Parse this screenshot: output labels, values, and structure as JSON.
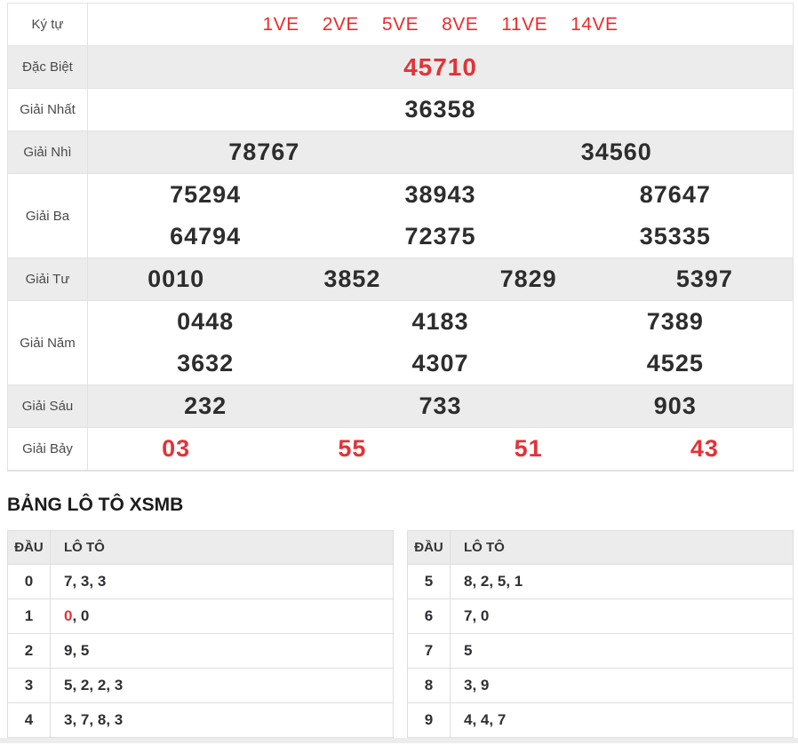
{
  "colors": {
    "red_accent": "#e23337",
    "symbol_red": "#ee2b2b",
    "number_dark": "#2d2d2d",
    "row_shade": "#ececec",
    "border": "#dedede"
  },
  "results_table": {
    "rows": [
      {
        "name": "ky-tu",
        "label": "Ký tự",
        "style": "symbols",
        "red": true,
        "shade": false,
        "lines": [
          [
            "1VE",
            "2VE",
            "5VE",
            "8VE",
            "11VE",
            "14VE"
          ]
        ]
      },
      {
        "name": "dac-biet",
        "label": "Đặc Biệt",
        "style": "special",
        "red": true,
        "shade": true,
        "lines": [
          [
            "45710"
          ]
        ]
      },
      {
        "name": "giai-nhat",
        "label": "Giải Nhất",
        "style": "",
        "red": false,
        "shade": false,
        "lines": [
          [
            "36358"
          ]
        ]
      },
      {
        "name": "giai-nhi",
        "label": "Giải Nhì",
        "style": "",
        "red": false,
        "shade": true,
        "lines": [
          [
            "78767",
            "34560"
          ]
        ]
      },
      {
        "name": "giai-ba",
        "label": "Giải Ba",
        "style": "",
        "red": false,
        "shade": false,
        "lines": [
          [
            "75294",
            "38943",
            "87647"
          ],
          [
            "64794",
            "72375",
            "35335"
          ]
        ]
      },
      {
        "name": "giai-tu",
        "label": "Giải Tư",
        "style": "",
        "red": false,
        "shade": true,
        "lines": [
          [
            "0010",
            "3852",
            "7829",
            "5397"
          ]
        ]
      },
      {
        "name": "giai-nam",
        "label": "Giải Năm",
        "style": "",
        "red": false,
        "shade": false,
        "lines": [
          [
            "0448",
            "4183",
            "7389"
          ],
          [
            "3632",
            "4307",
            "4525"
          ]
        ]
      },
      {
        "name": "giai-sau",
        "label": "Giải Sáu",
        "style": "",
        "red": false,
        "shade": true,
        "lines": [
          [
            "232",
            "733",
            "903"
          ]
        ]
      },
      {
        "name": "giai-bay",
        "label": "Giải Bảy",
        "style": "",
        "red": true,
        "shade": false,
        "lines": [
          [
            "03",
            "55",
            "51",
            "43"
          ]
        ]
      }
    ]
  },
  "loto_section": {
    "heading": "BẢNG LÔ TÔ XSMB",
    "col_dau": "ĐẦU",
    "col_loto": "LÔ TÔ",
    "tables": [
      {
        "name": "loto-table-0-4",
        "rows": [
          {
            "dau": "0",
            "values": [
              "7",
              "3",
              "3"
            ],
            "red": []
          },
          {
            "dau": "1",
            "values": [
              "0",
              "0"
            ],
            "red": [
              0
            ]
          },
          {
            "dau": "2",
            "values": [
              "9",
              "5"
            ],
            "red": []
          },
          {
            "dau": "3",
            "values": [
              "5",
              "2",
              "2",
              "3"
            ],
            "red": []
          },
          {
            "dau": "4",
            "values": [
              "3",
              "7",
              "8",
              "3"
            ],
            "red": []
          }
        ]
      },
      {
        "name": "loto-table-5-9",
        "rows": [
          {
            "dau": "5",
            "values": [
              "8",
              "2",
              "5",
              "1"
            ],
            "red": []
          },
          {
            "dau": "6",
            "values": [
              "7",
              "0"
            ],
            "red": []
          },
          {
            "dau": "7",
            "values": [
              "5"
            ],
            "red": []
          },
          {
            "dau": "8",
            "values": [
              "3",
              "9"
            ],
            "red": []
          },
          {
            "dau": "9",
            "values": [
              "4",
              "4",
              "7"
            ],
            "red": []
          }
        ]
      }
    ]
  }
}
